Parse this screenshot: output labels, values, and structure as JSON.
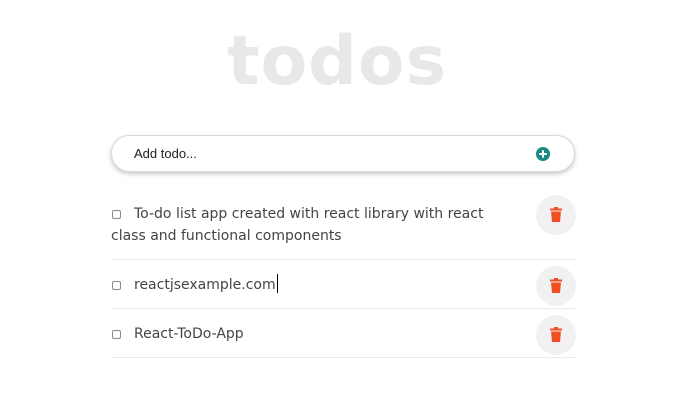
{
  "header": {
    "title": "todos"
  },
  "add_todo": {
    "placeholder": "Add todo...",
    "add_icon": "plus-circle-icon",
    "accent_color": "#1a8a84"
  },
  "todos": [
    {
      "text": "To-do list app created with react library with react class and functional components",
      "completed": false
    },
    {
      "text": "reactjsexample.com",
      "completed": false,
      "editing": true
    },
    {
      "text": "React-ToDo-App",
      "completed": false
    }
  ],
  "delete_icon": "trash-icon",
  "delete_color": "#f04e23"
}
